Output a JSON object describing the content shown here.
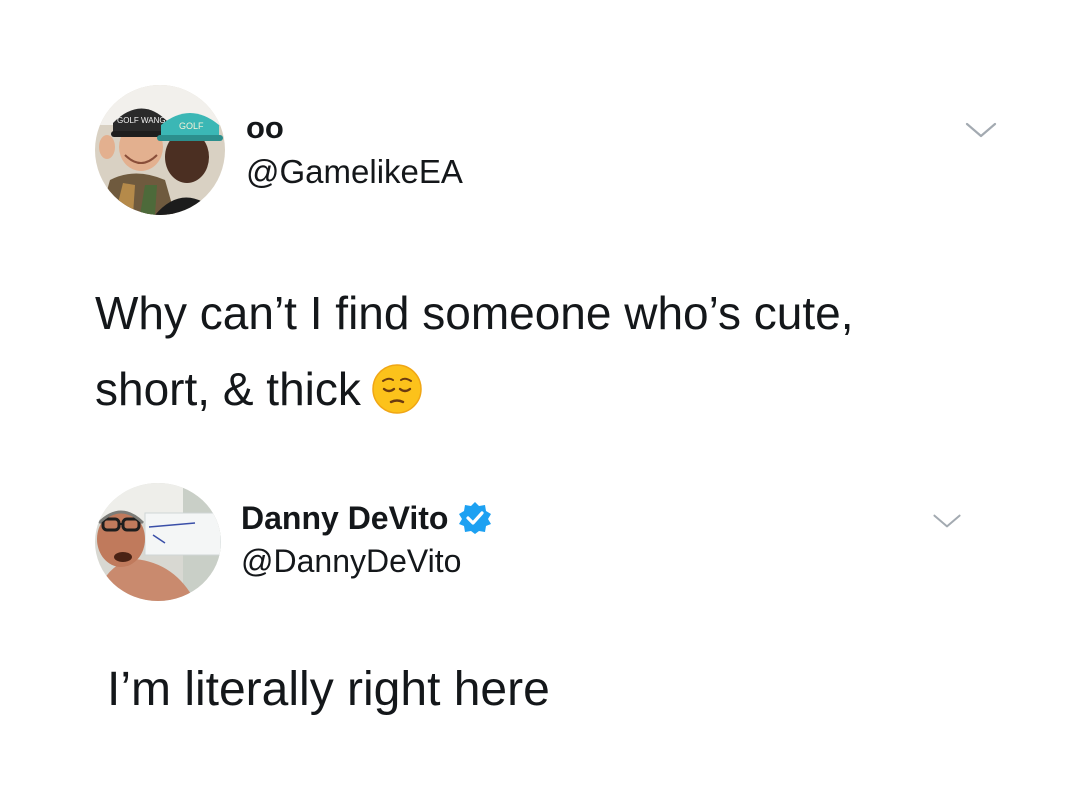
{
  "tweets": [
    {
      "display_name": "oo",
      "handle": "@GamelikeEA",
      "verified": false,
      "text_lines": [
        "Why can’t I find someone who’s cute,",
        "short, & thick"
      ],
      "avatar_icon": "profile-photo-two-men-golf-caps",
      "avatar_cap_text_1": "GOLF WANG",
      "avatar_cap_text_2": "GOLF",
      "emoji": "pensive-face-icon",
      "menu_icon": "chevron-down-icon"
    },
    {
      "display_name": "Danny DeVito",
      "handle": "@DannyDeVito",
      "verified": true,
      "verified_icon": "verified-badge-icon",
      "text": "I’m literally right here",
      "avatar_icon": "profile-photo-man-with-sign",
      "menu_icon": "chevron-down-icon"
    }
  ],
  "colors": {
    "text": "#14171a",
    "verified_blue": "#1da1f2",
    "chevron": "#a3aab1",
    "background": "#ffffff"
  }
}
